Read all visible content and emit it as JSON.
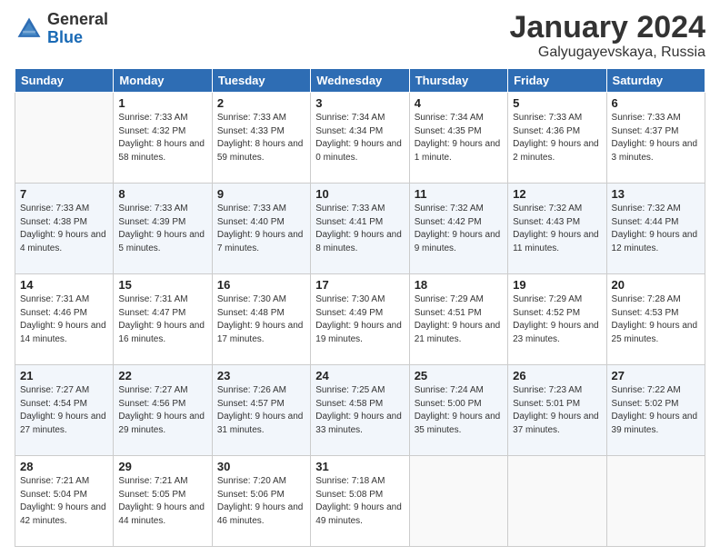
{
  "header": {
    "logo_general": "General",
    "logo_blue": "Blue",
    "month_title": "January 2024",
    "location": "Galyugayevskaya, Russia"
  },
  "weekdays": [
    "Sunday",
    "Monday",
    "Tuesday",
    "Wednesday",
    "Thursday",
    "Friday",
    "Saturday"
  ],
  "weeks": [
    [
      {
        "day": "",
        "sunrise": "",
        "sunset": "",
        "daylight": ""
      },
      {
        "day": "1",
        "sunrise": "Sunrise: 7:33 AM",
        "sunset": "Sunset: 4:32 PM",
        "daylight": "Daylight: 8 hours and 58 minutes."
      },
      {
        "day": "2",
        "sunrise": "Sunrise: 7:33 AM",
        "sunset": "Sunset: 4:33 PM",
        "daylight": "Daylight: 8 hours and 59 minutes."
      },
      {
        "day": "3",
        "sunrise": "Sunrise: 7:34 AM",
        "sunset": "Sunset: 4:34 PM",
        "daylight": "Daylight: 9 hours and 0 minutes."
      },
      {
        "day": "4",
        "sunrise": "Sunrise: 7:34 AM",
        "sunset": "Sunset: 4:35 PM",
        "daylight": "Daylight: 9 hours and 1 minute."
      },
      {
        "day": "5",
        "sunrise": "Sunrise: 7:33 AM",
        "sunset": "Sunset: 4:36 PM",
        "daylight": "Daylight: 9 hours and 2 minutes."
      },
      {
        "day": "6",
        "sunrise": "Sunrise: 7:33 AM",
        "sunset": "Sunset: 4:37 PM",
        "daylight": "Daylight: 9 hours and 3 minutes."
      }
    ],
    [
      {
        "day": "7",
        "sunrise": "Sunrise: 7:33 AM",
        "sunset": "Sunset: 4:38 PM",
        "daylight": "Daylight: 9 hours and 4 minutes."
      },
      {
        "day": "8",
        "sunrise": "Sunrise: 7:33 AM",
        "sunset": "Sunset: 4:39 PM",
        "daylight": "Daylight: 9 hours and 5 minutes."
      },
      {
        "day": "9",
        "sunrise": "Sunrise: 7:33 AM",
        "sunset": "Sunset: 4:40 PM",
        "daylight": "Daylight: 9 hours and 7 minutes."
      },
      {
        "day": "10",
        "sunrise": "Sunrise: 7:33 AM",
        "sunset": "Sunset: 4:41 PM",
        "daylight": "Daylight: 9 hours and 8 minutes."
      },
      {
        "day": "11",
        "sunrise": "Sunrise: 7:32 AM",
        "sunset": "Sunset: 4:42 PM",
        "daylight": "Daylight: 9 hours and 9 minutes."
      },
      {
        "day": "12",
        "sunrise": "Sunrise: 7:32 AM",
        "sunset": "Sunset: 4:43 PM",
        "daylight": "Daylight: 9 hours and 11 minutes."
      },
      {
        "day": "13",
        "sunrise": "Sunrise: 7:32 AM",
        "sunset": "Sunset: 4:44 PM",
        "daylight": "Daylight: 9 hours and 12 minutes."
      }
    ],
    [
      {
        "day": "14",
        "sunrise": "Sunrise: 7:31 AM",
        "sunset": "Sunset: 4:46 PM",
        "daylight": "Daylight: 9 hours and 14 minutes."
      },
      {
        "day": "15",
        "sunrise": "Sunrise: 7:31 AM",
        "sunset": "Sunset: 4:47 PM",
        "daylight": "Daylight: 9 hours and 16 minutes."
      },
      {
        "day": "16",
        "sunrise": "Sunrise: 7:30 AM",
        "sunset": "Sunset: 4:48 PM",
        "daylight": "Daylight: 9 hours and 17 minutes."
      },
      {
        "day": "17",
        "sunrise": "Sunrise: 7:30 AM",
        "sunset": "Sunset: 4:49 PM",
        "daylight": "Daylight: 9 hours and 19 minutes."
      },
      {
        "day": "18",
        "sunrise": "Sunrise: 7:29 AM",
        "sunset": "Sunset: 4:51 PM",
        "daylight": "Daylight: 9 hours and 21 minutes."
      },
      {
        "day": "19",
        "sunrise": "Sunrise: 7:29 AM",
        "sunset": "Sunset: 4:52 PM",
        "daylight": "Daylight: 9 hours and 23 minutes."
      },
      {
        "day": "20",
        "sunrise": "Sunrise: 7:28 AM",
        "sunset": "Sunset: 4:53 PM",
        "daylight": "Daylight: 9 hours and 25 minutes."
      }
    ],
    [
      {
        "day": "21",
        "sunrise": "Sunrise: 7:27 AM",
        "sunset": "Sunset: 4:54 PM",
        "daylight": "Daylight: 9 hours and 27 minutes."
      },
      {
        "day": "22",
        "sunrise": "Sunrise: 7:27 AM",
        "sunset": "Sunset: 4:56 PM",
        "daylight": "Daylight: 9 hours and 29 minutes."
      },
      {
        "day": "23",
        "sunrise": "Sunrise: 7:26 AM",
        "sunset": "Sunset: 4:57 PM",
        "daylight": "Daylight: 9 hours and 31 minutes."
      },
      {
        "day": "24",
        "sunrise": "Sunrise: 7:25 AM",
        "sunset": "Sunset: 4:58 PM",
        "daylight": "Daylight: 9 hours and 33 minutes."
      },
      {
        "day": "25",
        "sunrise": "Sunrise: 7:24 AM",
        "sunset": "Sunset: 5:00 PM",
        "daylight": "Daylight: 9 hours and 35 minutes."
      },
      {
        "day": "26",
        "sunrise": "Sunrise: 7:23 AM",
        "sunset": "Sunset: 5:01 PM",
        "daylight": "Daylight: 9 hours and 37 minutes."
      },
      {
        "day": "27",
        "sunrise": "Sunrise: 7:22 AM",
        "sunset": "Sunset: 5:02 PM",
        "daylight": "Daylight: 9 hours and 39 minutes."
      }
    ],
    [
      {
        "day": "28",
        "sunrise": "Sunrise: 7:21 AM",
        "sunset": "Sunset: 5:04 PM",
        "daylight": "Daylight: 9 hours and 42 minutes."
      },
      {
        "day": "29",
        "sunrise": "Sunrise: 7:21 AM",
        "sunset": "Sunset: 5:05 PM",
        "daylight": "Daylight: 9 hours and 44 minutes."
      },
      {
        "day": "30",
        "sunrise": "Sunrise: 7:20 AM",
        "sunset": "Sunset: 5:06 PM",
        "daylight": "Daylight: 9 hours and 46 minutes."
      },
      {
        "day": "31",
        "sunrise": "Sunrise: 7:18 AM",
        "sunset": "Sunset: 5:08 PM",
        "daylight": "Daylight: 9 hours and 49 minutes."
      },
      {
        "day": "",
        "sunrise": "",
        "sunset": "",
        "daylight": ""
      },
      {
        "day": "",
        "sunrise": "",
        "sunset": "",
        "daylight": ""
      },
      {
        "day": "",
        "sunrise": "",
        "sunset": "",
        "daylight": ""
      }
    ]
  ]
}
